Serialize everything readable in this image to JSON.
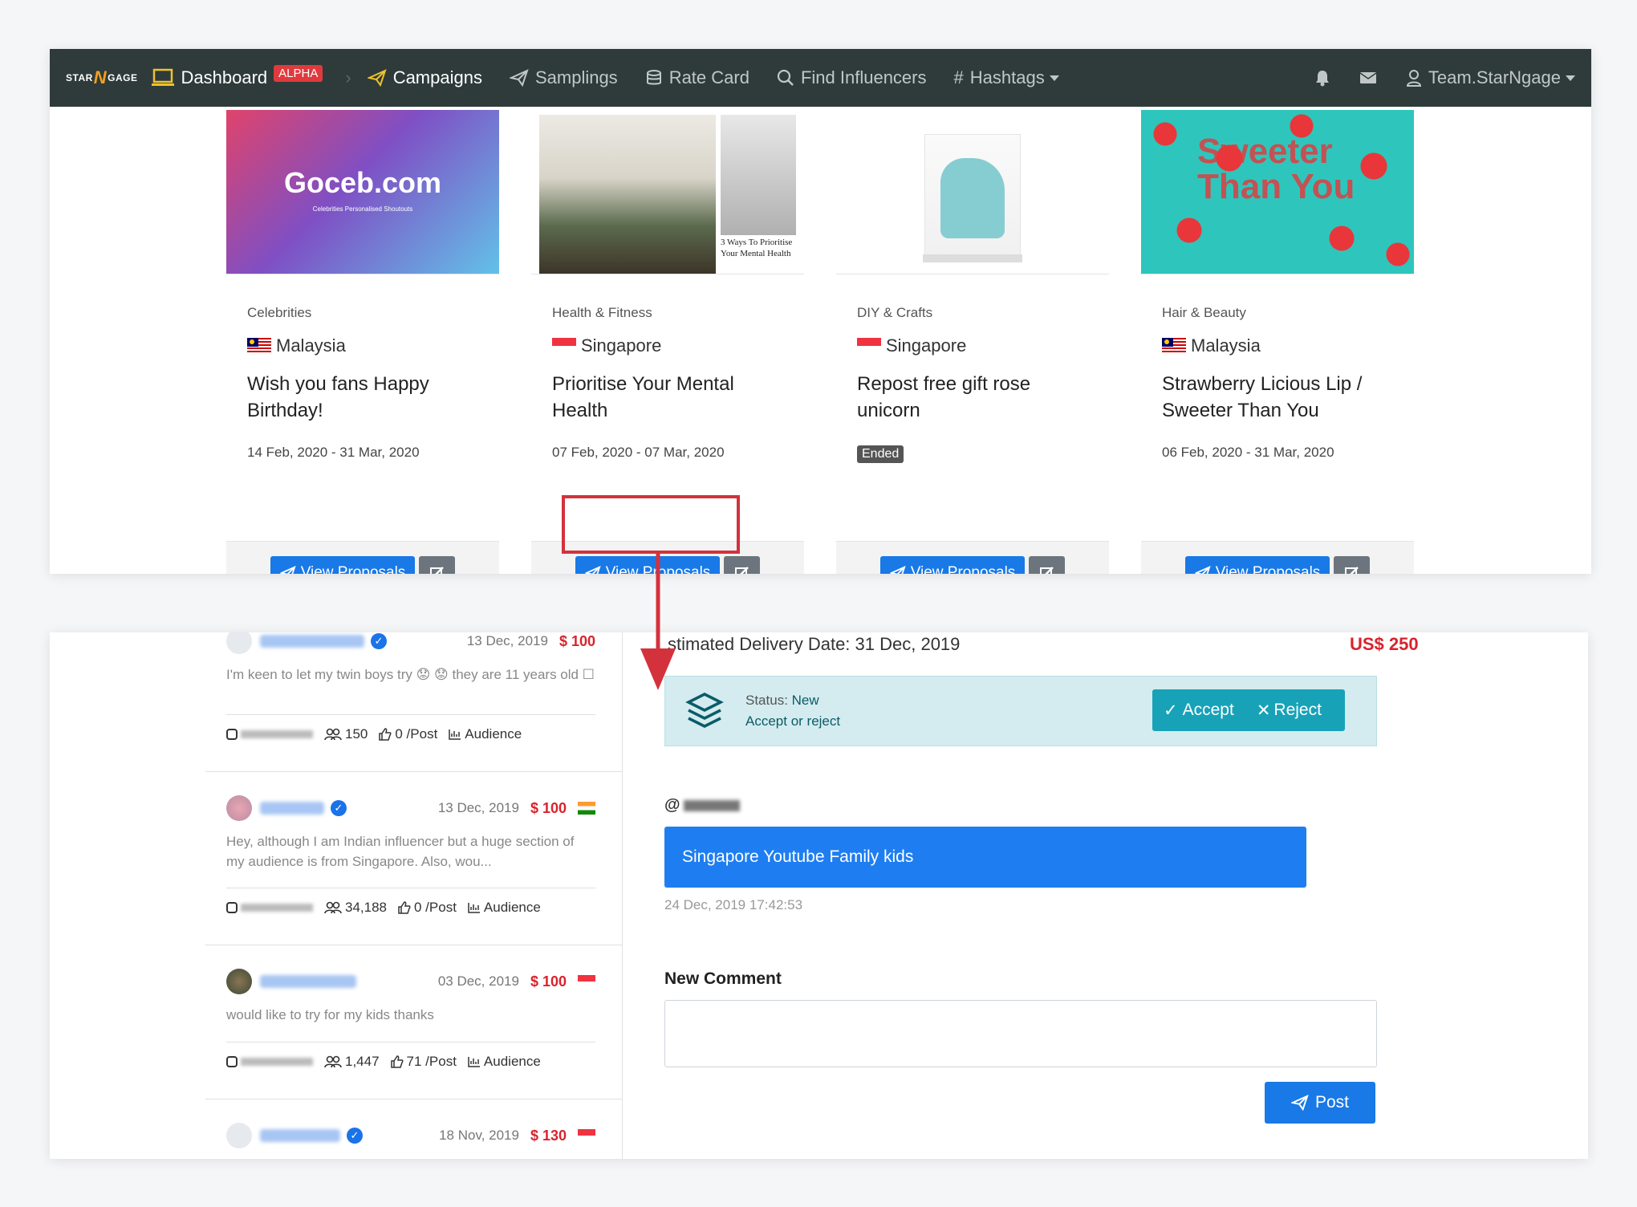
{
  "navbar": {
    "brand": {
      "left": "STAR",
      "mid": "N",
      "right": "GAGE"
    },
    "items": [
      {
        "label": "Dashboard",
        "icon": "laptop-icon",
        "badge": "ALPHA"
      },
      {
        "label": "Campaigns",
        "icon": "paper-plane-icon"
      },
      {
        "label": "Samplings",
        "icon": "paper-plane-icon"
      },
      {
        "label": "Rate Card",
        "icon": "database-icon"
      },
      {
        "label": "Find Influencers",
        "icon": "search-icon"
      },
      {
        "label": "Hashtags",
        "icon": "hash-icon"
      }
    ],
    "user": "Team.StarNgage"
  },
  "campaigns": [
    {
      "image_text": "Goceb.com",
      "image_sub": "Celebrities Personalised Shoutouts",
      "category": "Celebrities",
      "country": "Malaysia",
      "title": "Wish you fans Happy Birthday!",
      "date": "14 Feb, 2020 - 31 Mar, 2020",
      "button": "View Proposals"
    },
    {
      "image_text": "3 Ways To Prioritise Your Mental Health",
      "category": "Health & Fitness",
      "country": "Singapore",
      "title": "Prioritise Your Mental Health",
      "date": "07 Feb, 2020 - 07 Mar, 2020",
      "button": "View Proposals"
    },
    {
      "category": "DIY & Crafts",
      "country": "Singapore",
      "title": "Repost free gift rose unicorn",
      "status": "Ended",
      "button": "View Proposals"
    },
    {
      "image_text": "Sweeter Than You",
      "category": "Hair & Beauty",
      "country": "Malaysia",
      "title": "Strawberry Licious Lip / Sweeter Than You",
      "date": "06 Feb, 2020 - 31 Mar, 2020",
      "button": "View Proposals"
    }
  ],
  "proposals": [
    {
      "date": "13 Dec, 2019",
      "price": "$ 100",
      "message": "I'm keen to let my twin boys try 😟 😟  they are 11 years old ☐",
      "followers": "150",
      "engagement": "0 /Post",
      "audience": "Audience"
    },
    {
      "date": "13 Dec, 2019",
      "price": "$ 100",
      "message": "Hey, although I am Indian influencer but a huge section of my audience is from Singapore. Also, wou...",
      "followers": "34,188",
      "engagement": "0 /Post",
      "audience": "Audience"
    },
    {
      "date": "03 Dec, 2019",
      "price": "$ 100",
      "message": "would like to try for my kids thanks",
      "followers": "1,447",
      "engagement": "71 /Post",
      "audience": "Audience"
    },
    {
      "date": "18 Nov, 2019",
      "price": "$ 130"
    }
  ],
  "detail": {
    "delivery": "stimated Delivery Date: 31 Dec, 2019",
    "total": "US$ 250",
    "status_label": "Status:",
    "status_value": "New",
    "status_hint": "Accept or reject",
    "accept": "Accept",
    "reject": "Reject",
    "handle_prefix": "@",
    "message": "Singapore Youtube Family kids",
    "timestamp": "24 Dec, 2019 17:42:53",
    "new_comment_label": "New Comment",
    "post": "Post"
  },
  "colors": {
    "navbar": "#2e3b3a",
    "primary": "#1979e6",
    "danger": "#d9232d",
    "info": "#17a2b8"
  }
}
